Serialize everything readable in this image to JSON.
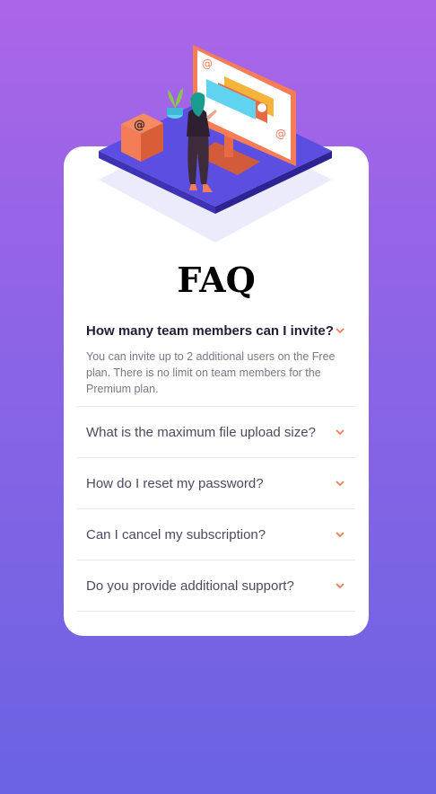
{
  "page": {
    "title": "FAQ"
  },
  "faq": [
    {
      "question": "How many team members can I invite?",
      "answer": "You can invite up to 2 additional users on the Free plan. There is no limit on team members for the Premium plan.",
      "open": true
    },
    {
      "question": "What is the maximum file upload size?",
      "open": false
    },
    {
      "question": "How do I reset my password?",
      "open": false
    },
    {
      "question": "Can I cancel my subscription?",
      "open": false
    },
    {
      "question": "Do you provide additional support?",
      "open": false
    }
  ],
  "colors": {
    "accent": "#f47c57",
    "gradient_top": "#ab65e8",
    "gradient_bottom": "#6a63e2",
    "text_dark": "#1e1f36",
    "text_muted": "#787887"
  },
  "icons": {
    "chevron": "chevron-down-icon",
    "illustration": "woman-online-illustration"
  }
}
